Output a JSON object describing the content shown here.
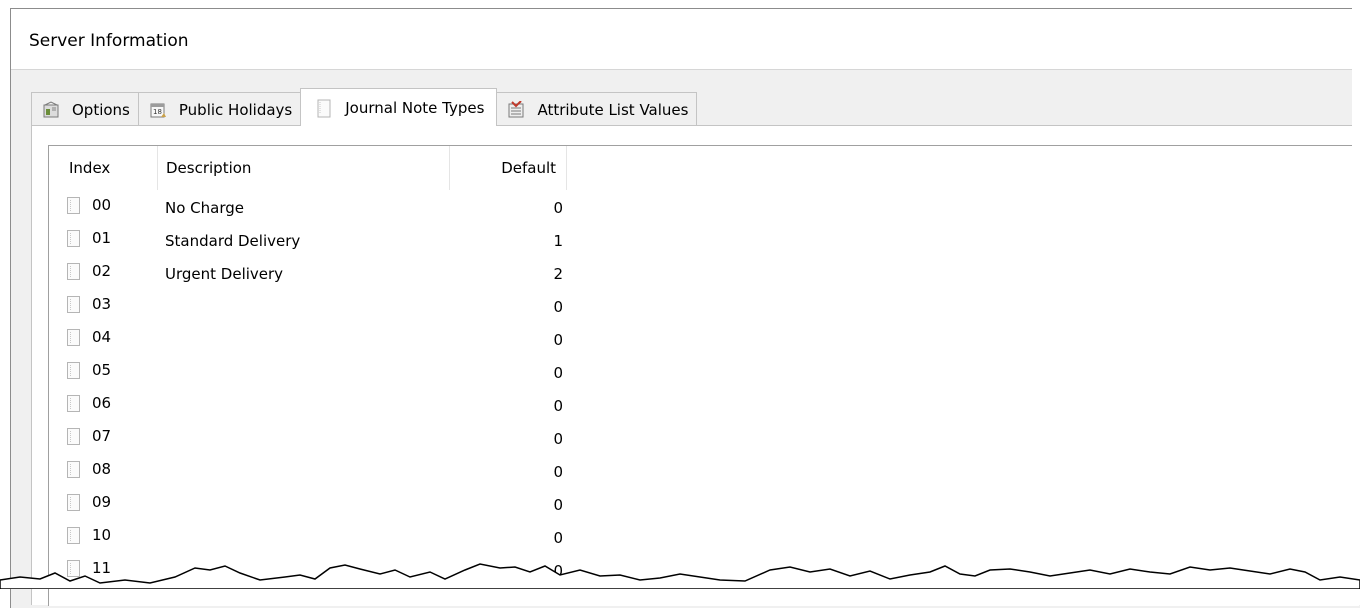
{
  "window": {
    "title": "Server Information"
  },
  "tabs": [
    {
      "label": "Options",
      "icon": "options-icon",
      "active": false
    },
    {
      "label": "Public Holidays",
      "icon": "calendar-icon",
      "active": false
    },
    {
      "label": "Journal Note Types",
      "icon": "journal-icon",
      "active": true
    },
    {
      "label": "Attribute List Values",
      "icon": "list-values-icon",
      "active": false
    }
  ],
  "table": {
    "columns": [
      "Index",
      "Description",
      "Default"
    ],
    "rows": [
      {
        "index": "00",
        "description": "No Charge",
        "default": "0"
      },
      {
        "index": "01",
        "description": "Standard Delivery",
        "default": "1"
      },
      {
        "index": "02",
        "description": "Urgent Delivery",
        "default": "2"
      },
      {
        "index": "03",
        "description": "",
        "default": "0"
      },
      {
        "index": "04",
        "description": "",
        "default": "0"
      },
      {
        "index": "05",
        "description": "",
        "default": "0"
      },
      {
        "index": "06",
        "description": "",
        "default": "0"
      },
      {
        "index": "07",
        "description": "",
        "default": "0"
      },
      {
        "index": "08",
        "description": "",
        "default": "0"
      },
      {
        "index": "09",
        "description": "",
        "default": "0"
      },
      {
        "index": "10",
        "description": "",
        "default": "0"
      },
      {
        "index": "11",
        "description": "",
        "default": "0"
      }
    ]
  },
  "colors": {
    "tab_border": "#c4c4c4",
    "panel_bg": "#ffffff",
    "window_bg": "#f0f0f0"
  }
}
